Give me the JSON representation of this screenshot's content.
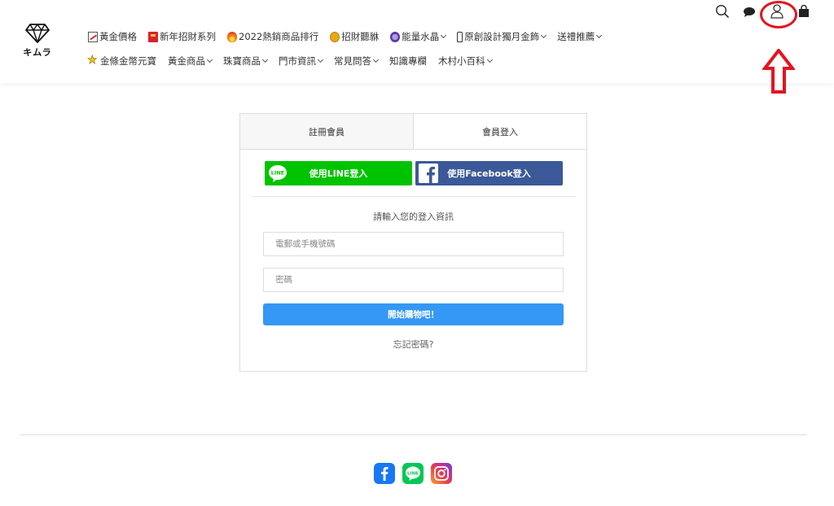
{
  "logo": {
    "text": "キムラ"
  },
  "nav": {
    "row1": [
      {
        "label": "黃金價格",
        "icon": "chart-icon",
        "caret": false
      },
      {
        "label": "新年招財系列",
        "icon": "red-envelope-icon",
        "caret": false
      },
      {
        "label": "2022熱銷商品排行",
        "icon": "fire-icon",
        "caret": false
      },
      {
        "label": "招財聽貅",
        "icon": "medal-icon",
        "caret": false
      },
      {
        "label": "能量水晶",
        "icon": "crystal-icon",
        "caret": true
      },
      {
        "label": "原創設計獨月金飾",
        "icon": "bottle-icon",
        "caret": true
      },
      {
        "label": "送禮推薦",
        "icon": "",
        "caret": true
      }
    ],
    "row2": [
      {
        "label": "金條金幣元寶",
        "icon": "star-icon",
        "caret": false
      },
      {
        "label": "黃金商品",
        "icon": "",
        "caret": true
      },
      {
        "label": "珠寶商品",
        "icon": "",
        "caret": true
      },
      {
        "label": "門市資訊",
        "icon": "",
        "caret": true
      },
      {
        "label": "常見問答",
        "icon": "",
        "caret": true
      },
      {
        "label": "知識專欄",
        "icon": "",
        "caret": false
      },
      {
        "label": "木村小百科",
        "icon": "",
        "caret": true
      }
    ]
  },
  "header_icons": [
    "search-icon",
    "chat-icon",
    "user-icon",
    "cart-icon"
  ],
  "annotation": {
    "color": "#e3141e"
  },
  "login": {
    "tabs": {
      "register": "註冊會員",
      "login": "會員登入"
    },
    "active_tab": "login",
    "line_button": "使用LINE登入",
    "line_badge": "LINE",
    "facebook_button": "使用Facebook登入",
    "prompt": "請輸入您的登入資訊",
    "email_placeholder": "電郵或手機號碼",
    "password_placeholder": "密碼",
    "submit": "開始購物吧！",
    "forgot": "忘記密碼?"
  },
  "footer": {
    "social": [
      "facebook-icon",
      "line-icon",
      "instagram-icon"
    ],
    "line_badge": "LINE"
  },
  "colors": {
    "line_green": "#00c300",
    "facebook_blue": "#3b5998",
    "primary_blue": "#3598f5"
  }
}
